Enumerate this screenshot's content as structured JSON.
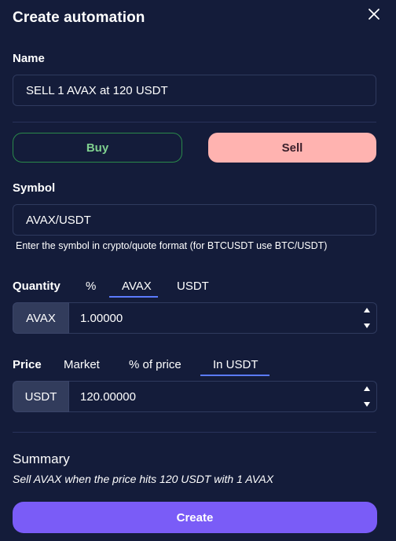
{
  "dialog": {
    "title": "Create automation",
    "close_icon": "close-icon"
  },
  "name": {
    "label": "Name",
    "value": "SELL 1 AVAX at 120 USDT"
  },
  "side": {
    "buy_label": "Buy",
    "sell_label": "Sell",
    "selected": "Sell"
  },
  "symbol": {
    "label": "Symbol",
    "value": "AVAX/USDT",
    "hint": "Enter the symbol in crypto/quote format (for BTCUSDT use BTC/USDT)"
  },
  "quantity": {
    "label": "Quantity",
    "tabs": [
      "%",
      "AVAX",
      "USDT"
    ],
    "selected_tab": "AVAX",
    "unit": "AVAX",
    "value": "1.00000"
  },
  "price": {
    "label": "Price",
    "tabs": [
      "Market",
      "% of price",
      "In USDT"
    ],
    "selected_tab": "In USDT",
    "unit": "USDT",
    "value": "120.00000"
  },
  "summary": {
    "title": "Summary",
    "text": "Sell AVAX when the price hits 120 USDT with 1 AVAX"
  },
  "actions": {
    "create_label": "Create"
  },
  "colors": {
    "background": "#141c3a",
    "buy_border": "#2a8a4a",
    "sell_fill": "#ffb3b0",
    "accent_underline": "#5b7bff",
    "create_button": "#7a5cf7"
  }
}
